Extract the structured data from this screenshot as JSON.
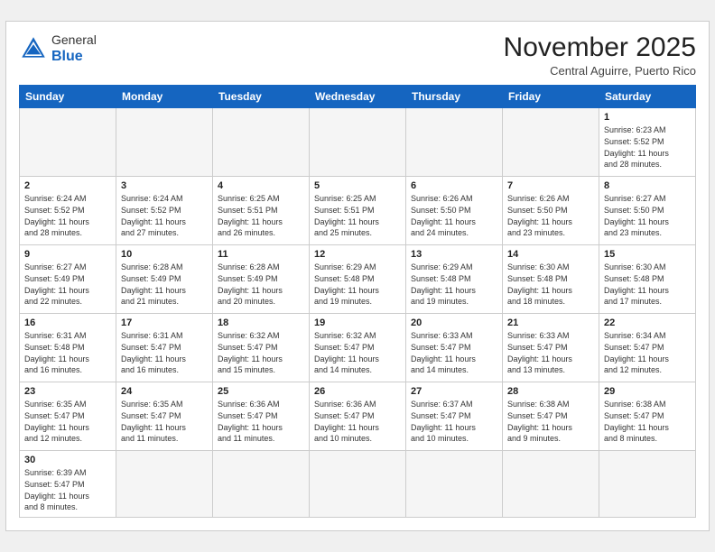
{
  "header": {
    "logo_general": "General",
    "logo_blue": "Blue",
    "month_title": "November 2025",
    "location": "Central Aguirre, Puerto Rico"
  },
  "days_of_week": [
    "Sunday",
    "Monday",
    "Tuesday",
    "Wednesday",
    "Thursday",
    "Friday",
    "Saturday"
  ],
  "weeks": [
    [
      {
        "day": "",
        "info": ""
      },
      {
        "day": "",
        "info": ""
      },
      {
        "day": "",
        "info": ""
      },
      {
        "day": "",
        "info": ""
      },
      {
        "day": "",
        "info": ""
      },
      {
        "day": "",
        "info": ""
      },
      {
        "day": "1",
        "info": "Sunrise: 6:23 AM\nSunset: 5:52 PM\nDaylight: 11 hours\nand 28 minutes."
      }
    ],
    [
      {
        "day": "2",
        "info": "Sunrise: 6:24 AM\nSunset: 5:52 PM\nDaylight: 11 hours\nand 28 minutes."
      },
      {
        "day": "3",
        "info": "Sunrise: 6:24 AM\nSunset: 5:52 PM\nDaylight: 11 hours\nand 27 minutes."
      },
      {
        "day": "4",
        "info": "Sunrise: 6:25 AM\nSunset: 5:51 PM\nDaylight: 11 hours\nand 26 minutes."
      },
      {
        "day": "5",
        "info": "Sunrise: 6:25 AM\nSunset: 5:51 PM\nDaylight: 11 hours\nand 25 minutes."
      },
      {
        "day": "6",
        "info": "Sunrise: 6:26 AM\nSunset: 5:50 PM\nDaylight: 11 hours\nand 24 minutes."
      },
      {
        "day": "7",
        "info": "Sunrise: 6:26 AM\nSunset: 5:50 PM\nDaylight: 11 hours\nand 23 minutes."
      },
      {
        "day": "8",
        "info": "Sunrise: 6:27 AM\nSunset: 5:50 PM\nDaylight: 11 hours\nand 23 minutes."
      }
    ],
    [
      {
        "day": "9",
        "info": "Sunrise: 6:27 AM\nSunset: 5:49 PM\nDaylight: 11 hours\nand 22 minutes."
      },
      {
        "day": "10",
        "info": "Sunrise: 6:28 AM\nSunset: 5:49 PM\nDaylight: 11 hours\nand 21 minutes."
      },
      {
        "day": "11",
        "info": "Sunrise: 6:28 AM\nSunset: 5:49 PM\nDaylight: 11 hours\nand 20 minutes."
      },
      {
        "day": "12",
        "info": "Sunrise: 6:29 AM\nSunset: 5:48 PM\nDaylight: 11 hours\nand 19 minutes."
      },
      {
        "day": "13",
        "info": "Sunrise: 6:29 AM\nSunset: 5:48 PM\nDaylight: 11 hours\nand 19 minutes."
      },
      {
        "day": "14",
        "info": "Sunrise: 6:30 AM\nSunset: 5:48 PM\nDaylight: 11 hours\nand 18 minutes."
      },
      {
        "day": "15",
        "info": "Sunrise: 6:30 AM\nSunset: 5:48 PM\nDaylight: 11 hours\nand 17 minutes."
      }
    ],
    [
      {
        "day": "16",
        "info": "Sunrise: 6:31 AM\nSunset: 5:48 PM\nDaylight: 11 hours\nand 16 minutes."
      },
      {
        "day": "17",
        "info": "Sunrise: 6:31 AM\nSunset: 5:47 PM\nDaylight: 11 hours\nand 16 minutes."
      },
      {
        "day": "18",
        "info": "Sunrise: 6:32 AM\nSunset: 5:47 PM\nDaylight: 11 hours\nand 15 minutes."
      },
      {
        "day": "19",
        "info": "Sunrise: 6:32 AM\nSunset: 5:47 PM\nDaylight: 11 hours\nand 14 minutes."
      },
      {
        "day": "20",
        "info": "Sunrise: 6:33 AM\nSunset: 5:47 PM\nDaylight: 11 hours\nand 14 minutes."
      },
      {
        "day": "21",
        "info": "Sunrise: 6:33 AM\nSunset: 5:47 PM\nDaylight: 11 hours\nand 13 minutes."
      },
      {
        "day": "22",
        "info": "Sunrise: 6:34 AM\nSunset: 5:47 PM\nDaylight: 11 hours\nand 12 minutes."
      }
    ],
    [
      {
        "day": "23",
        "info": "Sunrise: 6:35 AM\nSunset: 5:47 PM\nDaylight: 11 hours\nand 12 minutes."
      },
      {
        "day": "24",
        "info": "Sunrise: 6:35 AM\nSunset: 5:47 PM\nDaylight: 11 hours\nand 11 minutes."
      },
      {
        "day": "25",
        "info": "Sunrise: 6:36 AM\nSunset: 5:47 PM\nDaylight: 11 hours\nand 11 minutes."
      },
      {
        "day": "26",
        "info": "Sunrise: 6:36 AM\nSunset: 5:47 PM\nDaylight: 11 hours\nand 10 minutes."
      },
      {
        "day": "27",
        "info": "Sunrise: 6:37 AM\nSunset: 5:47 PM\nDaylight: 11 hours\nand 10 minutes."
      },
      {
        "day": "28",
        "info": "Sunrise: 6:38 AM\nSunset: 5:47 PM\nDaylight: 11 hours\nand 9 minutes."
      },
      {
        "day": "29",
        "info": "Sunrise: 6:38 AM\nSunset: 5:47 PM\nDaylight: 11 hours\nand 8 minutes."
      }
    ],
    [
      {
        "day": "30",
        "info": "Sunrise: 6:39 AM\nSunset: 5:47 PM\nDaylight: 11 hours\nand 8 minutes."
      },
      {
        "day": "",
        "info": ""
      },
      {
        "day": "",
        "info": ""
      },
      {
        "day": "",
        "info": ""
      },
      {
        "day": "",
        "info": ""
      },
      {
        "day": "",
        "info": ""
      },
      {
        "day": "",
        "info": ""
      }
    ]
  ]
}
